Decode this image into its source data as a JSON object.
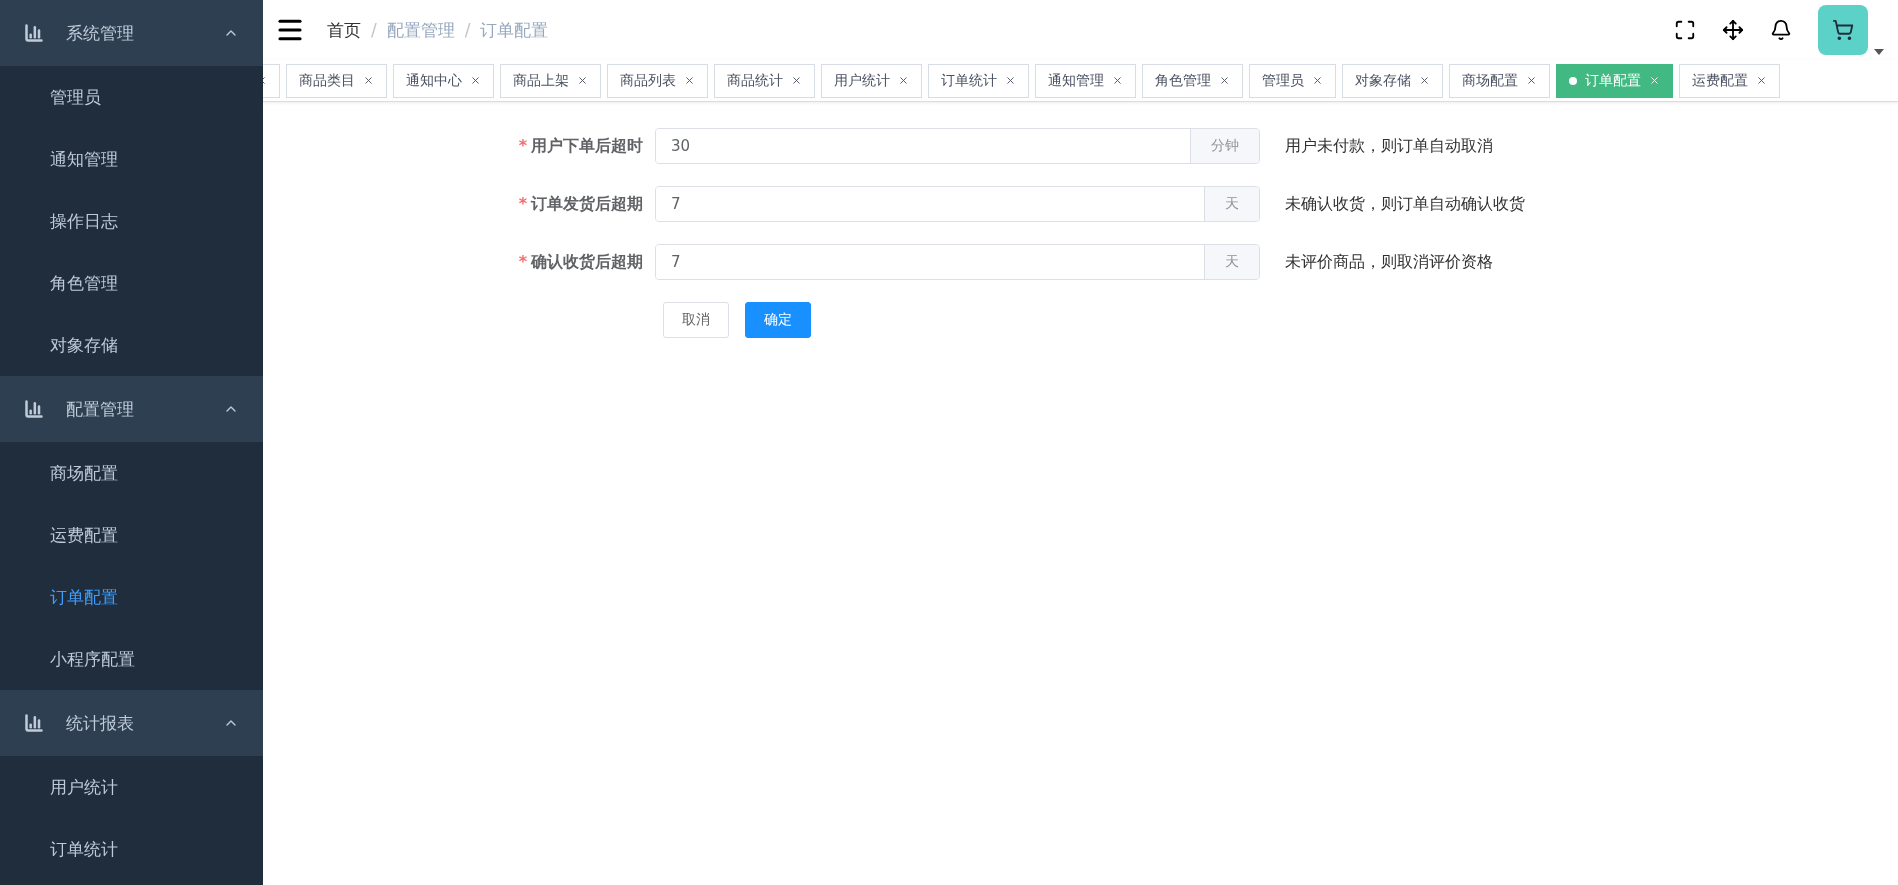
{
  "sidebar": {
    "groups": [
      {
        "title": "系统管理",
        "expanded": true,
        "items": [
          {
            "label": "管理员",
            "selected": false
          },
          {
            "label": "通知管理",
            "selected": false
          },
          {
            "label": "操作日志",
            "selected": false
          },
          {
            "label": "角色管理",
            "selected": false
          },
          {
            "label": "对象存储",
            "selected": false
          }
        ]
      },
      {
        "title": "配置管理",
        "expanded": true,
        "items": [
          {
            "label": "商场配置",
            "selected": false
          },
          {
            "label": "运费配置",
            "selected": false
          },
          {
            "label": "订单配置",
            "selected": true
          },
          {
            "label": "小程序配置",
            "selected": false
          }
        ]
      },
      {
        "title": "统计报表",
        "expanded": true,
        "items": [
          {
            "label": "用户统计",
            "selected": false
          },
          {
            "label": "订单统计",
            "selected": false
          }
        ]
      }
    ]
  },
  "breadcrumb": {
    "separator": "/",
    "items": [
      "首页",
      "配置管理",
      "订单配置"
    ]
  },
  "tabs": [
    {
      "kind": "clipped",
      "selected": false
    },
    {
      "kind": "tab",
      "label": "商品类目",
      "selected": false
    },
    {
      "kind": "tab",
      "label": "通知中心",
      "selected": false
    },
    {
      "kind": "tab",
      "label": "商品上架",
      "selected": false
    },
    {
      "kind": "tab",
      "label": "商品列表",
      "selected": false
    },
    {
      "kind": "tab",
      "label": "商品统计",
      "selected": false
    },
    {
      "kind": "tab",
      "label": "用户统计",
      "selected": false
    },
    {
      "kind": "tab",
      "label": "订单统计",
      "selected": false
    },
    {
      "kind": "tab",
      "label": "通知管理",
      "selected": false
    },
    {
      "kind": "tab",
      "label": "角色管理",
      "selected": false
    },
    {
      "kind": "tab",
      "label": "管理员",
      "selected": false
    },
    {
      "kind": "tab",
      "label": "对象存储",
      "selected": false
    },
    {
      "kind": "tab",
      "label": "商场配置",
      "selected": false
    },
    {
      "kind": "tab",
      "label": "订单配置",
      "selected": true
    },
    {
      "kind": "tab",
      "label": "运费配置",
      "selected": false
    }
  ],
  "form": {
    "fields": [
      {
        "label": "用户下单后超时",
        "required_mark": "*",
        "value": "30",
        "unit": "分钟",
        "hint": "用户未付款，则订单自动取消"
      },
      {
        "label": "订单发货后超期",
        "required_mark": "*",
        "value": "7",
        "unit": "天",
        "hint": "未确认收货，则订单自动确认收货"
      },
      {
        "label": "确认收货后超期",
        "required_mark": "*",
        "value": "7",
        "unit": "天",
        "hint": "未评价商品，则取消评价资格"
      }
    ],
    "buttons": [
      {
        "kind": "default",
        "label": "取消"
      },
      {
        "kind": "primary",
        "label": "确定"
      }
    ]
  }
}
